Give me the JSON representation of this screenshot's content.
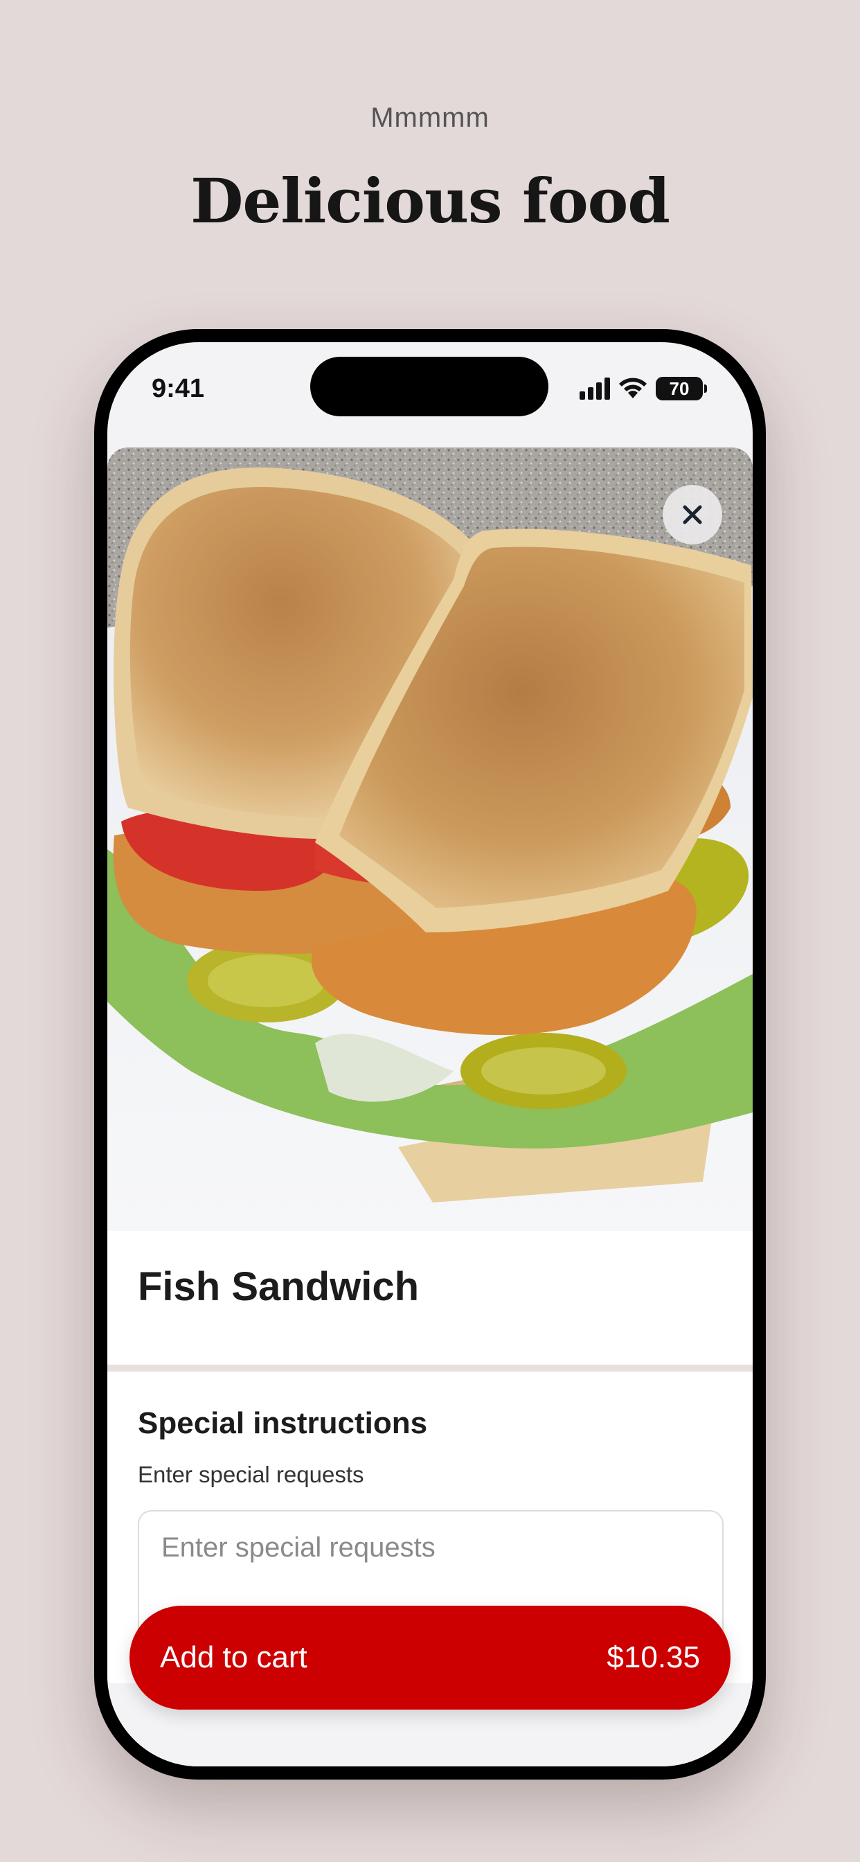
{
  "page": {
    "eyebrow": "Mmmmm",
    "headline": "Delicious food"
  },
  "status_bar": {
    "time": "9:41",
    "battery": "70"
  },
  "item": {
    "image_icon": "fish-sandwich-photo",
    "name": "Fish Sandwich"
  },
  "instructions": {
    "title": "Special instructions",
    "subtitle": "Enter special requests",
    "placeholder": "Enter special requests"
  },
  "cart": {
    "label": "Add to cart",
    "price": "$10.35"
  },
  "colors": {
    "background": "#e3d9d8",
    "accent": "#cc0000"
  }
}
